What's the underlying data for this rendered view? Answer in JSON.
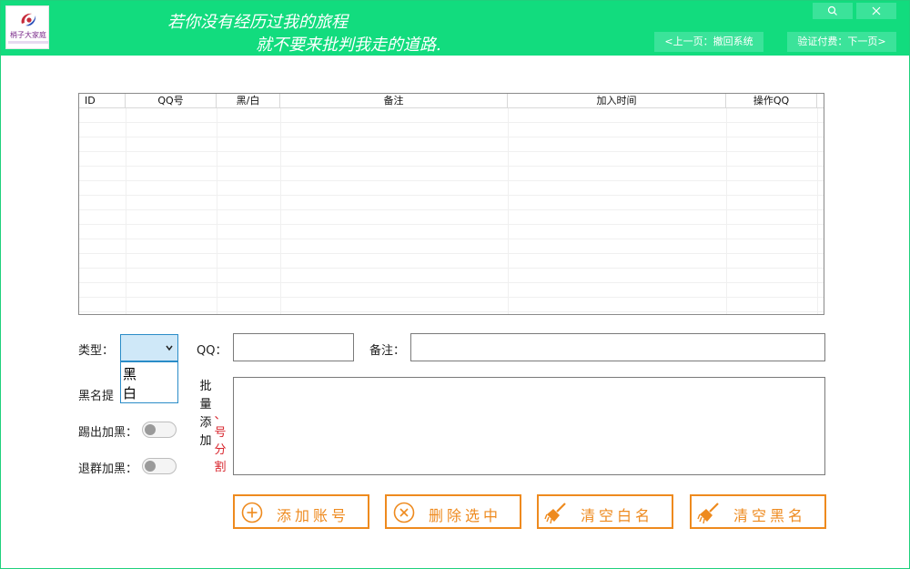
{
  "header": {
    "logo_text": "梢子大家庭",
    "motto_line1": "若你没有经历过我的旅程",
    "motto_line2": "就不要来批判我走的道路.",
    "prev_label": "<上一页：撤回系统",
    "next_label": "验证付费：下一页>"
  },
  "table": {
    "columns": [
      "ID",
      "QQ号",
      "黑/白",
      "备注",
      "加入时间",
      "操作QQ"
    ],
    "rows": []
  },
  "form": {
    "type_label": "类型：",
    "type_selected": "",
    "type_options": [
      "黑",
      "白"
    ],
    "qq_label": "QQ：",
    "qq_value": "",
    "remark_label": "备注：",
    "remark_value": "",
    "blacklist_prompt_label": "黑名提",
    "batch_label": "批量添加",
    "batch_hint": "、号分割",
    "batch_value": "",
    "kick_black_label": "踢出加黑：",
    "kick_black_on": false,
    "leave_black_label": "退群加黑：",
    "leave_black_on": false
  },
  "actions": {
    "add_account": "添加账号",
    "delete_selected": "删除选中",
    "clear_white": "清空白名",
    "clear_black": "清空黑名"
  },
  "colors": {
    "header_bg": "#12dc7e",
    "accent_orange": "#ee8a1e",
    "select_border": "#2a8cc8",
    "hint_red": "#d8262e"
  }
}
